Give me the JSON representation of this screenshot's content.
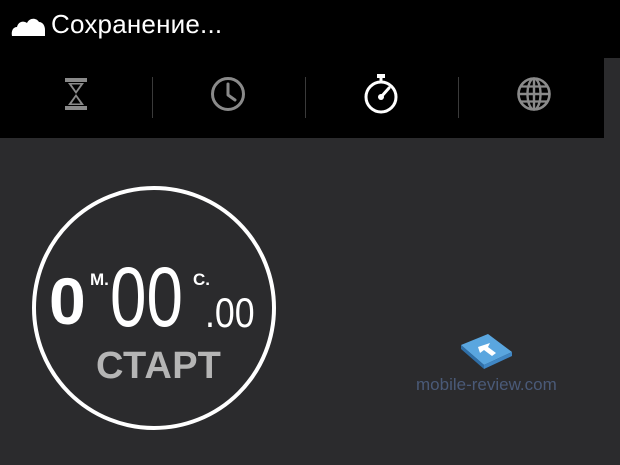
{
  "status_bar": {
    "icon": "cloud-icon",
    "text": "Сохранение..."
  },
  "tabs": [
    {
      "name": "timer",
      "icon": "hourglass-icon",
      "selected": false
    },
    {
      "name": "alarm",
      "icon": "clock-icon",
      "selected": false
    },
    {
      "name": "stopwatch",
      "icon": "stopwatch-icon",
      "selected": true
    },
    {
      "name": "world-clock",
      "icon": "globe-icon",
      "selected": false
    }
  ],
  "stopwatch": {
    "minutes": "0",
    "minutes_unit": "М.",
    "seconds": "00",
    "seconds_unit": "С.",
    "hundredths": ".00",
    "start_label": "СТАРТ"
  },
  "watermark": {
    "text": "mobile-review.com"
  },
  "colors": {
    "background": "#000000",
    "content_background": "#2b2b2d",
    "icon_inactive": "#8a8a8a",
    "icon_active": "#ffffff",
    "start_label": "#b5b5b5",
    "watermark_blue": "#5aa6df"
  }
}
